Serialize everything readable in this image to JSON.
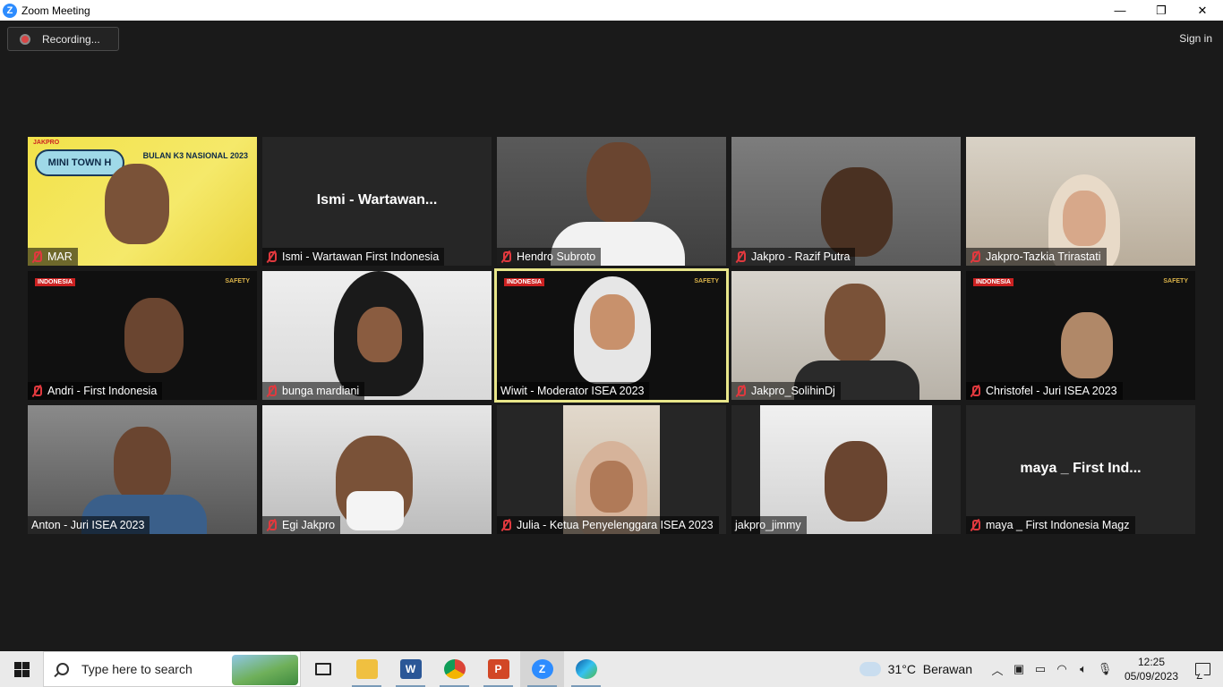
{
  "window": {
    "title": "Zoom Meeting",
    "minimize_glyph": "—",
    "maximize_glyph": "❐",
    "close_glyph": "✕"
  },
  "topbar": {
    "recording_label": "Recording...",
    "sign_in_label": "Sign in"
  },
  "tile_texts": {
    "jakpro_logo": "JAKPRO",
    "mini_town_hall": "MINI TOWN H",
    "bulan_k3": "BULAN K3 NASIONAL 2023",
    "media_logo": "INDONESIA",
    "safety_logo": "SAFETY"
  },
  "participants": [
    {
      "name": "MAR",
      "muted": true,
      "video": true
    },
    {
      "name": "Ismi - Wartawan First Indonesia",
      "display_title": "Ismi - Wartawan...",
      "muted": true,
      "video": false
    },
    {
      "name": "Hendro Subroto",
      "muted": true,
      "video": true
    },
    {
      "name": "Jakpro - Razif Putra",
      "muted": true,
      "video": true
    },
    {
      "name": "Jakpro-Tazkia Trirastati",
      "muted": true,
      "video": true
    },
    {
      "name": "Andri - First Indonesia",
      "muted": true,
      "video": true
    },
    {
      "name": "bunga mardiani",
      "muted": true,
      "video": true
    },
    {
      "name": "Wiwit - Moderator ISEA 2023",
      "muted": false,
      "video": true,
      "active_speaker": true
    },
    {
      "name": "Jakpro_SolihinDj",
      "muted": true,
      "video": true
    },
    {
      "name": "Christofel - Juri ISEA 2023",
      "muted": true,
      "video": true
    },
    {
      "name": "Anton - Juri ISEA 2023",
      "muted": false,
      "video": true
    },
    {
      "name": "Egi Jakpro",
      "muted": true,
      "video": true
    },
    {
      "name": "Julia - Ketua Penyelenggara ISEA 2023",
      "muted": true,
      "video": true
    },
    {
      "name": "jakpro_jimmy",
      "muted": false,
      "video": true
    },
    {
      "name": "maya _ First Indonesia Magz",
      "display_title": "maya _ First Ind...",
      "muted": true,
      "video": false
    }
  ],
  "taskbar": {
    "search_placeholder": "Type here to search",
    "apps": [
      "task-view",
      "file-explorer",
      "word",
      "chrome",
      "powerpoint",
      "zoom",
      "edge"
    ],
    "weather_temp": "31°C",
    "weather_desc": "Berawan",
    "time": "12:25",
    "date": "05/09/2023"
  }
}
